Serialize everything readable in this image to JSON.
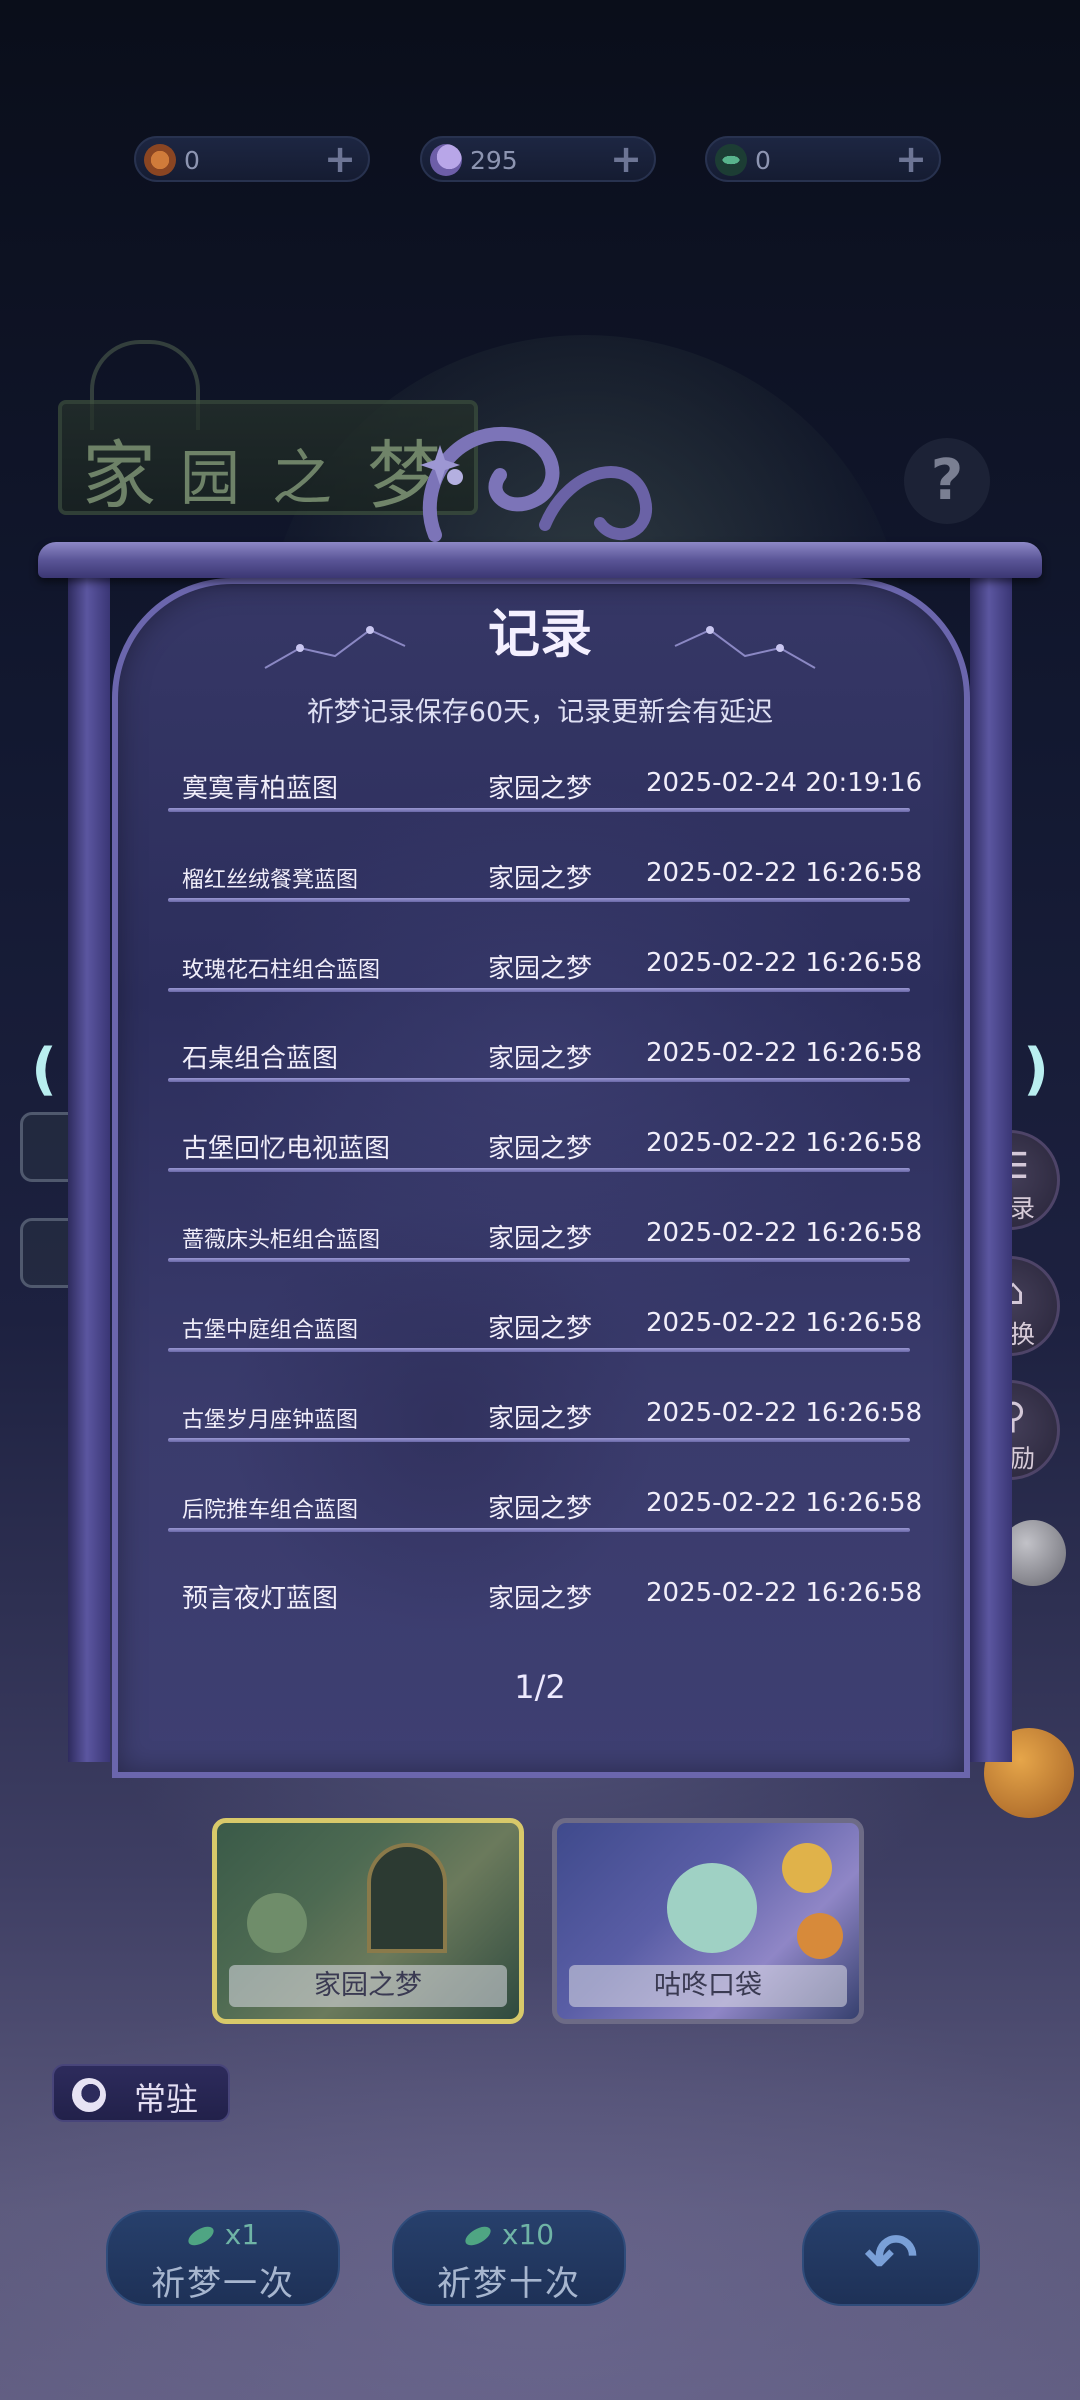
{
  "currencies": [
    {
      "name": "dream-coin",
      "value": "0",
      "plus": "+"
    },
    {
      "name": "moon-star",
      "value": "295",
      "plus": "+"
    },
    {
      "name": "green-leaf",
      "value": "0",
      "plus": "+"
    }
  ],
  "background": {
    "sign_chars": [
      "家",
      "园",
      "之",
      "梦"
    ]
  },
  "help": "?",
  "modal": {
    "title": "记录",
    "subtitle": "祈梦记录保存60天，记录更新会有延迟",
    "records": [
      {
        "item": "寞寞青柏蓝图",
        "pool": "家园之梦",
        "time": "2025-02-24 20:19:16"
      },
      {
        "item": "榴红丝绒餐凳蓝图",
        "pool": "家园之梦",
        "time": "2025-02-22 16:26:58"
      },
      {
        "item": "玫瑰花石柱组合蓝图",
        "pool": "家园之梦",
        "time": "2025-02-22 16:26:58"
      },
      {
        "item": "石桌组合蓝图",
        "pool": "家园之梦",
        "time": "2025-02-22 16:26:58"
      },
      {
        "item": "古堡回忆电视蓝图",
        "pool": "家园之梦",
        "time": "2025-02-22 16:26:58"
      },
      {
        "item": "蔷薇床头柜组合蓝图",
        "pool": "家园之梦",
        "time": "2025-02-22 16:26:58"
      },
      {
        "item": "古堡中庭组合蓝图",
        "pool": "家园之梦",
        "time": "2025-02-22 16:26:58"
      },
      {
        "item": "古堡岁月座钟蓝图",
        "pool": "家园之梦",
        "time": "2025-02-22 16:26:58"
      },
      {
        "item": "后院推车组合蓝图",
        "pool": "家园之梦",
        "time": "2025-02-22 16:26:58"
      },
      {
        "item": "预言夜灯蓝图",
        "pool": "家园之梦",
        "time": "2025-02-22 16:26:58"
      }
    ],
    "page": "1/2"
  },
  "arrows": {
    "left": "(",
    "right": ")"
  },
  "side_menu": [
    {
      "label": "记录",
      "icon": "list-icon",
      "glyph": "☰"
    },
    {
      "label": "兑换",
      "icon": "shop-icon",
      "glyph": "⌂"
    },
    {
      "label": "奖励",
      "icon": "magnifier-icon",
      "glyph": "⚲"
    }
  ],
  "pools": [
    {
      "label": "家园之梦",
      "selected": true
    },
    {
      "label": "咕咚口袋",
      "selected": false
    }
  ],
  "permanent_tab": "常驻",
  "pray": {
    "one": {
      "cost": "x1",
      "label": "祈梦一次"
    },
    "ten": {
      "cost": "x10",
      "label": "祈梦十次"
    }
  },
  "back_icon": "↶",
  "colors": {
    "accent_gold": "#d8c96a",
    "frame_purple": "#6b66ad",
    "arrow_cyan": "#b9eef0"
  }
}
